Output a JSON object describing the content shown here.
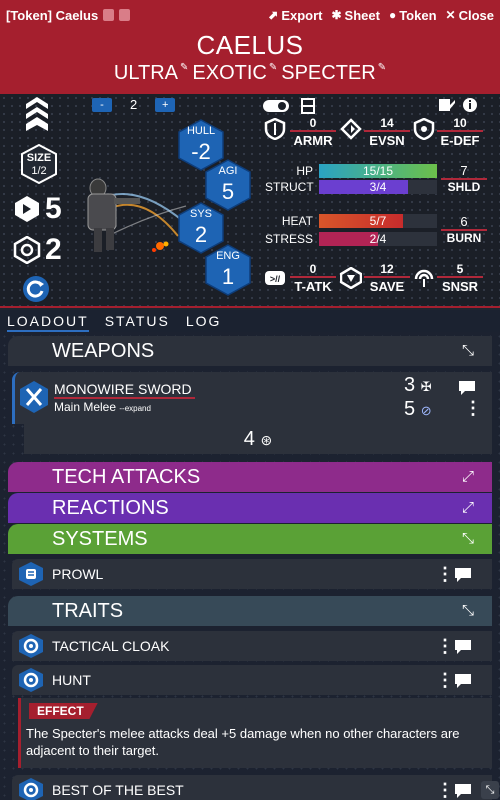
{
  "titlebar": {
    "title": "[Token] Caelus",
    "export": "Export",
    "sheet": "Sheet",
    "token": "Token",
    "close": "Close"
  },
  "header": {
    "name": "CAELUS",
    "tags": [
      "ULTRA",
      "EXOTIC",
      "SPECTER"
    ]
  },
  "stats": {
    "tier_value": "2",
    "size_label": "SIZE",
    "size_value": "1/2",
    "structure_big": "5",
    "stress_big": "2",
    "hexes": {
      "hull": {
        "label": "HULL",
        "value": "-2"
      },
      "agi": {
        "label": "AGI",
        "value": "5"
      },
      "sys": {
        "label": "SYS",
        "value": "2"
      },
      "eng": {
        "label": "ENG",
        "value": "1"
      }
    },
    "armr": {
      "label": "ARMR",
      "value": "0"
    },
    "evsn": {
      "label": "EVSN",
      "value": "14"
    },
    "edef": {
      "label": "E-DEF",
      "value": "10"
    },
    "hp": {
      "label": "HP",
      "text": "15/15",
      "fraction": 1.0
    },
    "struct": {
      "label": "STRUCT",
      "text": "3/4",
      "fraction": 0.75
    },
    "shld": {
      "label": "SHLD",
      "value": "7"
    },
    "heat": {
      "label": "HEAT",
      "text": "5/7",
      "fraction": 0.714
    },
    "stress": {
      "label": "STRESS",
      "text": "2/4",
      "fraction": 0.5
    },
    "burn": {
      "label": "BURN",
      "value": "6"
    },
    "tatk": {
      "label": "T-ATK",
      "value": "0"
    },
    "save": {
      "label": "SAVE",
      "value": "12"
    },
    "snsr": {
      "label": "SNSR",
      "value": "5"
    }
  },
  "tabs": [
    "LOADOUT",
    "STATUS",
    "LOG"
  ],
  "weapons": {
    "header": "WEAPONS",
    "item_name": "MONOWIRE SWORD",
    "item_sub": "Main Melee",
    "item_expand": "--expand",
    "range_value": "3",
    "damage_value": "5",
    "mount_value": "4"
  },
  "tech_attacks": {
    "header": "TECH ATTACKS"
  },
  "reactions": {
    "header": "REACTIONS"
  },
  "systems": {
    "header": "SYSTEMS",
    "items": [
      "PROWL"
    ]
  },
  "traits": {
    "header": "TRAITS",
    "items": [
      "TACTICAL CLOAK",
      "HUNT",
      "BEST OF THE BEST"
    ],
    "effect_label": "EFFECT",
    "effect_text": "The Specter's melee attacks deal +5 damage when no other characters are adjacent to their target."
  },
  "colors": {
    "red": "#a51f2e",
    "blue": "#1e64b4",
    "tech": "#8e2b8b",
    "reactions": "#6a2fb0",
    "systems": "#5aa136",
    "traits": "#374a58"
  }
}
